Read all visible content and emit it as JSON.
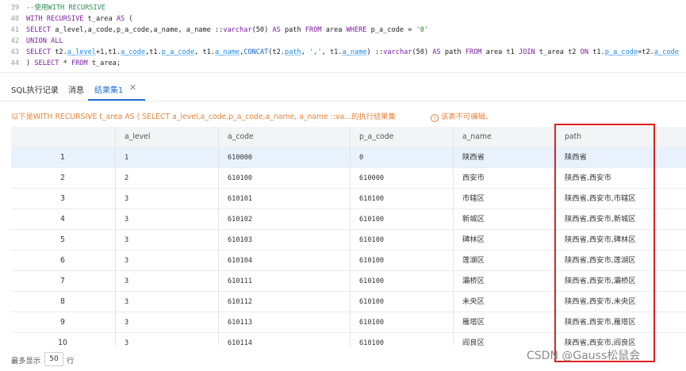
{
  "editor": {
    "lines": [
      {
        "num": "39",
        "tokens": [
          {
            "t": "--使用WITH RECURSIVE",
            "c": "c"
          }
        ]
      },
      {
        "num": "40",
        "tokens": [
          {
            "t": "WITH RECURSIVE ",
            "c": "k"
          },
          {
            "t": "t_area ",
            "c": "t"
          },
          {
            "t": "AS",
            "c": "k"
          },
          {
            "t": " (",
            "c": "t"
          }
        ]
      },
      {
        "num": "41",
        "tokens": [
          {
            "t": "SELECT ",
            "c": "k"
          },
          {
            "t": "a_level,a_code,p_a_code,a_name, a_name ::",
            "c": "t"
          },
          {
            "t": "varchar",
            "c": "k"
          },
          {
            "t": "(50) ",
            "c": "t"
          },
          {
            "t": "AS ",
            "c": "k"
          },
          {
            "t": "path ",
            "c": "t"
          },
          {
            "t": "FROM ",
            "c": "k"
          },
          {
            "t": "area ",
            "c": "t"
          },
          {
            "t": "WHERE ",
            "c": "k"
          },
          {
            "t": "p_a_code = ",
            "c": "t"
          },
          {
            "t": "'0'",
            "c": "s"
          }
        ]
      },
      {
        "num": "42",
        "tokens": [
          {
            "t": "UNION ALL",
            "c": "k"
          }
        ]
      },
      {
        "num": "43",
        "tokens": [
          {
            "t": "SELECT ",
            "c": "k"
          },
          {
            "t": "t2.",
            "c": "t"
          },
          {
            "t": "a_level",
            "c": "u"
          },
          {
            "t": "+1,t1.",
            "c": "t"
          },
          {
            "t": "a_code",
            "c": "u"
          },
          {
            "t": ",t1.",
            "c": "t"
          },
          {
            "t": "p_a_code",
            "c": "u"
          },
          {
            "t": ", t1.",
            "c": "t"
          },
          {
            "t": "a_name",
            "c": "u"
          },
          {
            "t": ",",
            "c": "t"
          },
          {
            "t": "CONCAT",
            "c": "f"
          },
          {
            "t": "(t2.",
            "c": "t"
          },
          {
            "t": "path",
            "c": "u"
          },
          {
            "t": ", ",
            "c": "t"
          },
          {
            "t": "','",
            "c": "s"
          },
          {
            "t": ", t1.",
            "c": "t"
          },
          {
            "t": "a_name",
            "c": "u"
          },
          {
            "t": ") ::",
            "c": "t"
          },
          {
            "t": "varchar",
            "c": "k"
          },
          {
            "t": "(50) ",
            "c": "t"
          },
          {
            "t": "AS ",
            "c": "k"
          },
          {
            "t": "path ",
            "c": "t"
          },
          {
            "t": "FROM ",
            "c": "k"
          },
          {
            "t": "area t1 ",
            "c": "t"
          },
          {
            "t": "JOIN ",
            "c": "k"
          },
          {
            "t": "t_area t2 ",
            "c": "t"
          },
          {
            "t": "ON ",
            "c": "k"
          },
          {
            "t": "t1.",
            "c": "t"
          },
          {
            "t": "p_a_code",
            "c": "u"
          },
          {
            "t": "=t2.",
            "c": "t"
          },
          {
            "t": "a_code",
            "c": "u"
          }
        ]
      },
      {
        "num": "44",
        "tokens": [
          {
            "t": ") ",
            "c": "t"
          },
          {
            "t": "SELECT ",
            "c": "k"
          },
          {
            "t": "* ",
            "c": "t"
          },
          {
            "t": "FROM ",
            "c": "k"
          },
          {
            "t": "t_area;",
            "c": "t"
          }
        ]
      }
    ]
  },
  "tabs": {
    "history": "SQL执行记录",
    "messages": "消息",
    "result": "结果集1",
    "close_glyph": "✕"
  },
  "info": {
    "summary": "以下是WITH RECURSIVE t_area AS ( SELECT a_level,a_code,p_a_code,a_name, a_name ::va...的执行结果集",
    "warn_glyph": "!",
    "readonly": "该表不可编辑。"
  },
  "table": {
    "columns": [
      "",
      "a_level",
      "a_code",
      "p_a_code",
      "a_name",
      "path"
    ],
    "rows": [
      [
        "1",
        "1",
        "610000",
        "0",
        "陕西省",
        "陕西省"
      ],
      [
        "2",
        "2",
        "610100",
        "610000",
        "西安市",
        "陕西省,西安市"
      ],
      [
        "3",
        "3",
        "610101",
        "610100",
        "市辖区",
        "陕西省,西安市,市辖区"
      ],
      [
        "4",
        "3",
        "610102",
        "610100",
        "新城区",
        "陕西省,西安市,新城区"
      ],
      [
        "5",
        "3",
        "610103",
        "610100",
        "碑林区",
        "陕西省,西安市,碑林区"
      ],
      [
        "6",
        "3",
        "610104",
        "610100",
        "莲湖区",
        "陕西省,西安市,莲湖区"
      ],
      [
        "7",
        "3",
        "610111",
        "610100",
        "灞桥区",
        "陕西省,西安市,灞桥区"
      ],
      [
        "8",
        "3",
        "610112",
        "610100",
        "未央区",
        "陕西省,西安市,未央区"
      ],
      [
        "9",
        "3",
        "610113",
        "610100",
        "雁塔区",
        "陕西省,西安市,雁塔区"
      ],
      [
        "10",
        "3",
        "610114",
        "610100",
        "阎良区",
        "陕西省,西安市,阎良区"
      ]
    ]
  },
  "footer": {
    "prefix": "最多显示",
    "page_size": "50",
    "suffix": "行"
  },
  "watermark": "CSDN @Gauss松鼠会",
  "colors": {
    "accent": "#1e6fd9",
    "warning": "#e8833a",
    "highlight_border": "#e02020",
    "selected_row": "#e9f2fc"
  }
}
